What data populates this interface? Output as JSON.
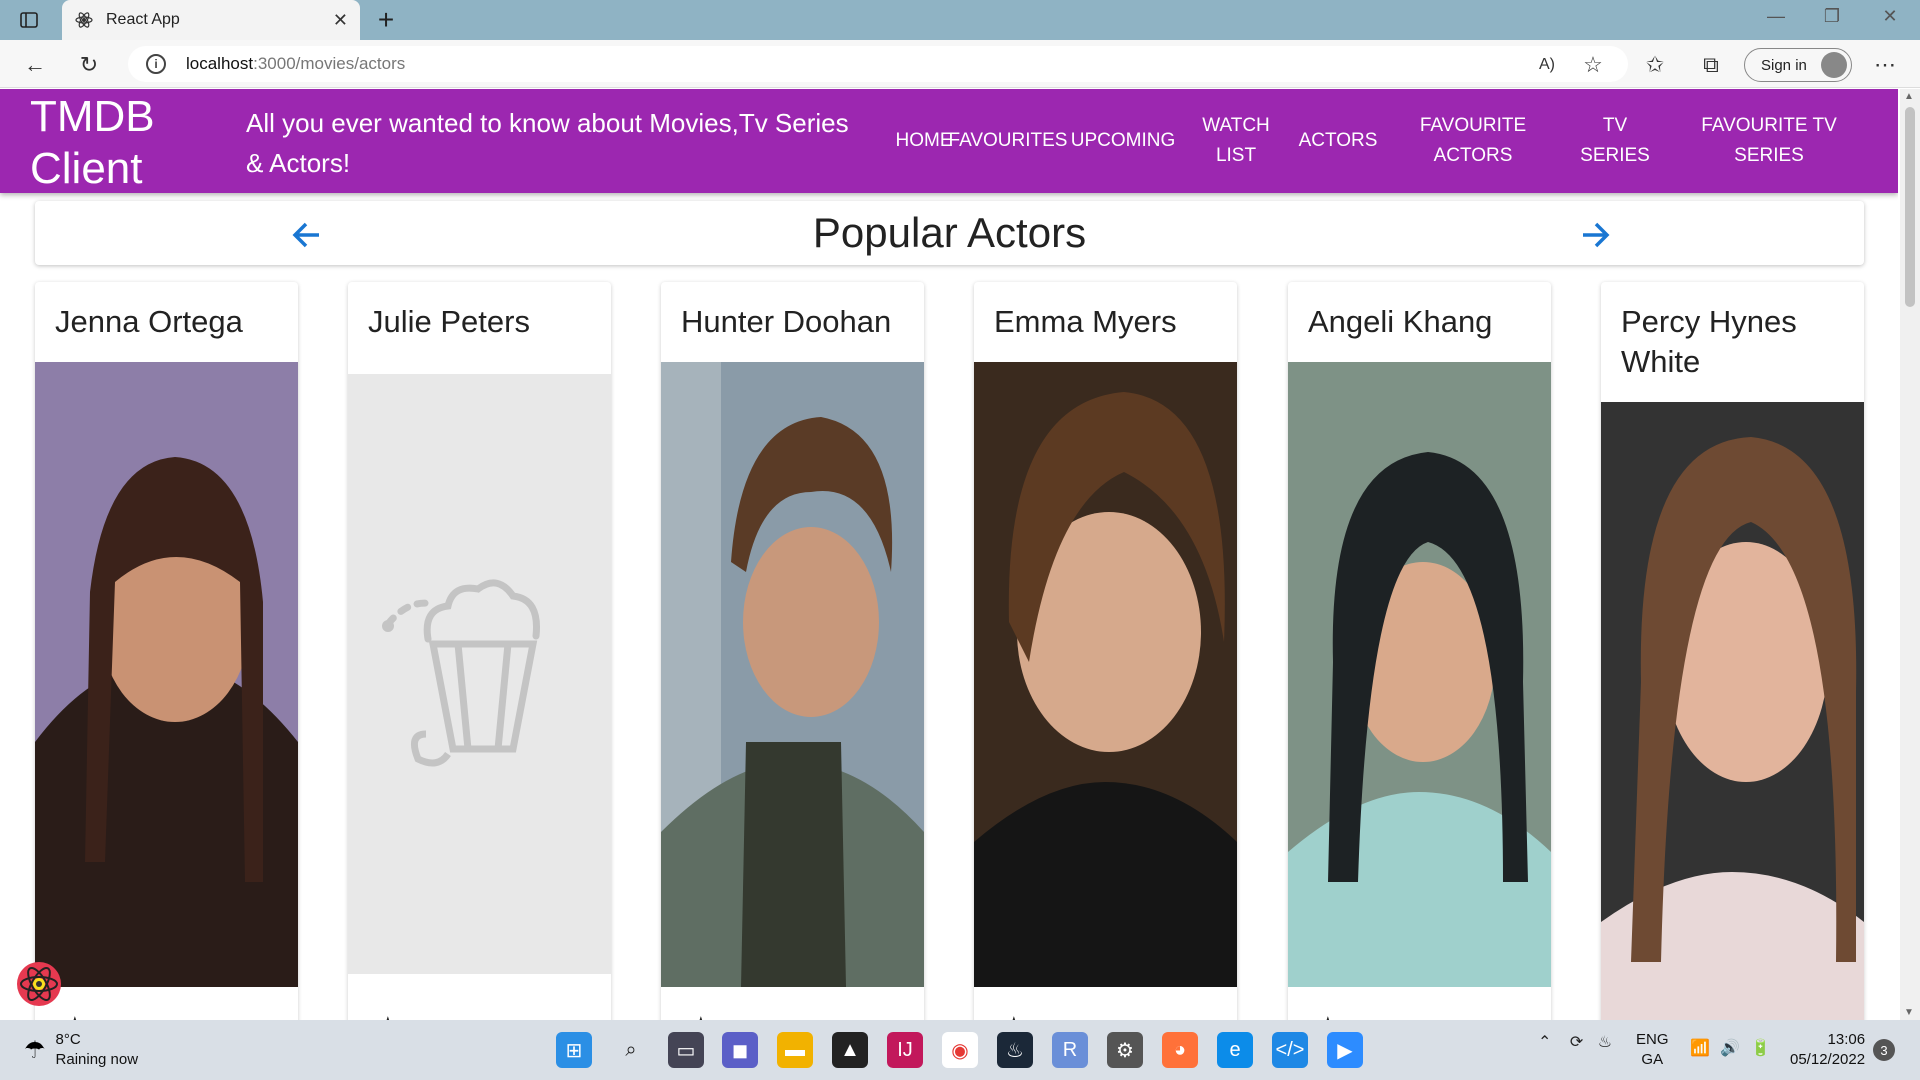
{
  "browser": {
    "tab_title": "React App",
    "url_host": "localhost",
    "url_path": ":3000/movies/actors",
    "signin_label": "Sign in"
  },
  "app": {
    "brand": "TMDB Client",
    "tagline": "All you ever wanted to know about Movies,Tv Series & Actors!",
    "nav": [
      "HOME",
      "FAVOURITES",
      "UPCOMING",
      "WATCH LIST",
      "ACTORS",
      "FAVOURITE ACTORS",
      "TV SERIES",
      "FAVOURITE TV SERIES"
    ],
    "accent_color": "#9c27b0"
  },
  "page": {
    "title": "Popular Actors",
    "actors": [
      {
        "name": "Jenna Ortega",
        "has_photo": true
      },
      {
        "name": "Julie Peters",
        "has_photo": false
      },
      {
        "name": "Hunter Doohan",
        "has_photo": true
      },
      {
        "name": "Emma Myers",
        "has_photo": true
      },
      {
        "name": "Angeli Khang",
        "has_photo": true
      },
      {
        "name": "Percy Hynes White",
        "has_photo": true
      }
    ]
  },
  "taskbar": {
    "temperature": "8°C",
    "weather": "Raining now",
    "lang_1": "ENG",
    "lang_2": "GA",
    "time": "13:06",
    "date": "05/12/2022",
    "notifications": "3"
  }
}
